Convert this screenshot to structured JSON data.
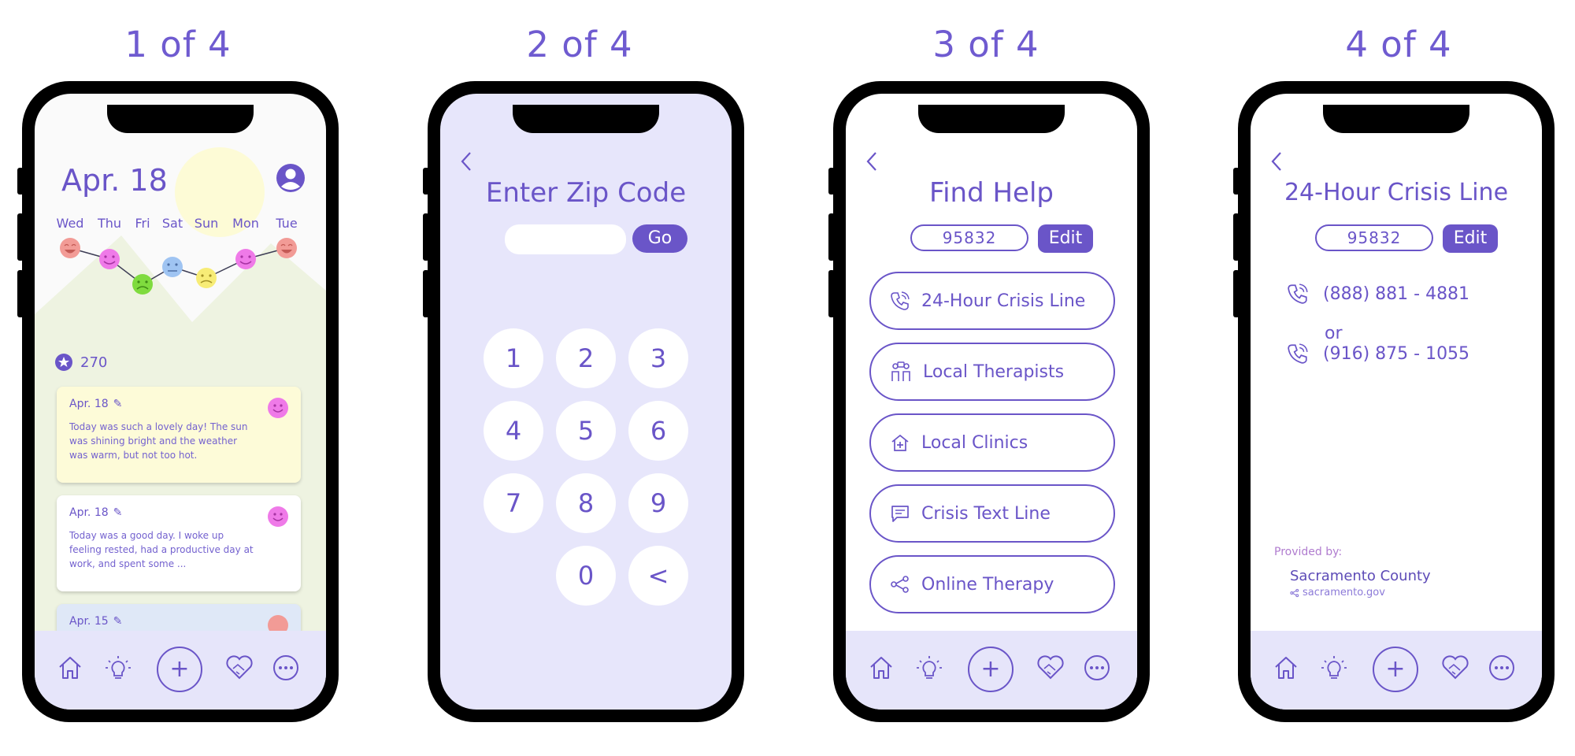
{
  "steps": [
    "1 of 4",
    "2 of 4",
    "3 of 4",
    "4 of 4"
  ],
  "colors": {
    "accent": "#6a55c8",
    "nav_bg": "#e6e5fa",
    "keypad_bg": "#e7e6fb",
    "sun": "#fdfbd6"
  },
  "nav_icons": [
    "home-icon",
    "lightbulb-icon",
    "plus-icon",
    "handshake-heart-icon",
    "more-icon"
  ],
  "screen1": {
    "date": "Apr. 18",
    "days": [
      "Wed",
      "Thu",
      "Fri",
      "Sat",
      "Sun",
      "Mon",
      "Tue"
    ],
    "moods": [
      "laughing",
      "happy",
      "sad",
      "neutral",
      "worried",
      "happy",
      "laughing"
    ],
    "points": "270",
    "entries": [
      {
        "date": "Apr. 18",
        "text": "Today was such a lovely day! The sun was shining bright and the weather was warm, but not too hot.",
        "mood": "happy",
        "bg": "#fdfbd8"
      },
      {
        "date": "Apr. 18",
        "text": "Today was a good day. I woke up feeling rested, had a productive day at work, and spent some ...",
        "mood": "happy",
        "bg": "#ffffff"
      },
      {
        "date": "Apr. 15",
        "text": "",
        "mood": "laughing",
        "bg": "#dfe8f7"
      }
    ]
  },
  "screen2": {
    "title": "Enter Zip Code",
    "zip_placeholder": "",
    "go_label": "Go",
    "keys": [
      "1",
      "2",
      "3",
      "4",
      "5",
      "6",
      "7",
      "8",
      "9",
      "0",
      "<"
    ]
  },
  "screen3": {
    "title": "Find Help",
    "zip": "95832",
    "edit_label": "Edit",
    "services": [
      {
        "label": "24-Hour Crisis Line",
        "icon": "phone-icon"
      },
      {
        "label": "Local Therapists",
        "icon": "therapists-icon"
      },
      {
        "label": "Local Clinics",
        "icon": "clinic-icon"
      },
      {
        "label": "Crisis Text Line",
        "icon": "chat-icon"
      },
      {
        "label": "Online Therapy",
        "icon": "share-icon"
      }
    ]
  },
  "screen4": {
    "title": "24-Hour Crisis Line",
    "zip": "95832",
    "edit_label": "Edit",
    "phone1": "(888) 881 - 4881",
    "or": "or",
    "phone2": "(916) 875 - 1055",
    "provided_by": "Provided by:",
    "provider": "Sacramento County",
    "provider_url": "sacramento.gov"
  }
}
